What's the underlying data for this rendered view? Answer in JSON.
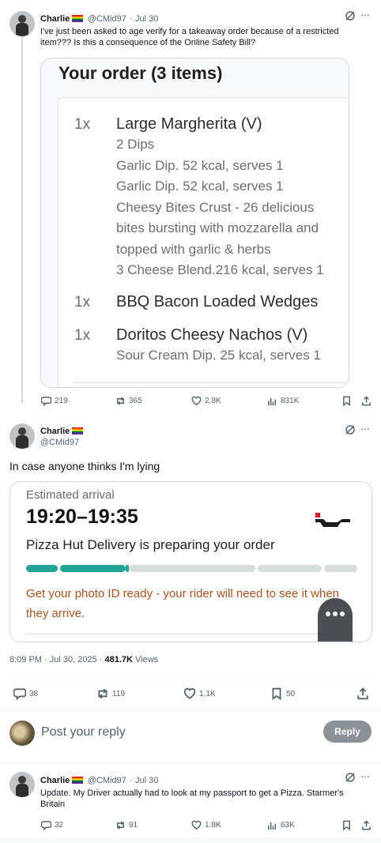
{
  "tweet1": {
    "name": "Charlie",
    "handle": "@CMid97",
    "time": "· Jul 30",
    "text": "I've just been asked to age verify for a takeaway order because of a restricted item??? Is this a consequence of the Online Safety Bill?",
    "order_title": "Your order (3 items)",
    "order_items": [
      {
        "qty": "1x",
        "name": "Large Margherita (V)",
        "details": [
          "2 Dips",
          "Garlic Dip. 52 kcal, serves 1",
          "Garlic Dip. 52 kcal, serves 1",
          "Cheesy Bites Crust - 26 delicious",
          "bites bursting with mozzarella and",
          "topped with garlic & herbs",
          "3 Cheese Blend.216 kcal, serves 1"
        ]
      },
      {
        "qty": "1x",
        "name": "BBQ Bacon Loaded Wedges",
        "details": []
      },
      {
        "qty": "1x",
        "name": "Doritos Cheesy Nachos (V)",
        "details": [
          "Sour Cream Dip. 25 kcal, serves 1"
        ]
      }
    ],
    "stats": {
      "replies": "219",
      "retweets": "365",
      "likes": "2.8K",
      "views": "831K"
    }
  },
  "tweet2": {
    "name": "Charlie",
    "handle": "@CMid97",
    "text": "In case anyone thinks I'm lying",
    "delivery": {
      "label": "Estimated arrival",
      "time_range": "19:20–19:35",
      "status": "Pizza Hut Delivery is preparing your order",
      "progress": 0.31,
      "warning": "Get your photo ID ready - your rider will need to see it when they arrive.",
      "progress_color": "#23a398",
      "warning_color": "#b5511c"
    },
    "timestamp": "8:09 PM · Jul 30, 2025 ·",
    "views_count": "481.7K",
    "views_label": "Views",
    "stats": {
      "replies": "38",
      "retweets": "119",
      "likes": "1.1K",
      "bookmarks": "50"
    }
  },
  "reply_box": {
    "placeholder": "Post your reply",
    "button": "Reply"
  },
  "tweet3": {
    "name": "Charlie",
    "handle": "@CMid97",
    "time": "· Jul 30",
    "text": "Update. My Driver actually had to look at my passport to get a Pizza. Starmer's Britain",
    "stats": {
      "replies": "32",
      "retweets": "91",
      "likes": "1.8K",
      "views": "63K"
    }
  }
}
